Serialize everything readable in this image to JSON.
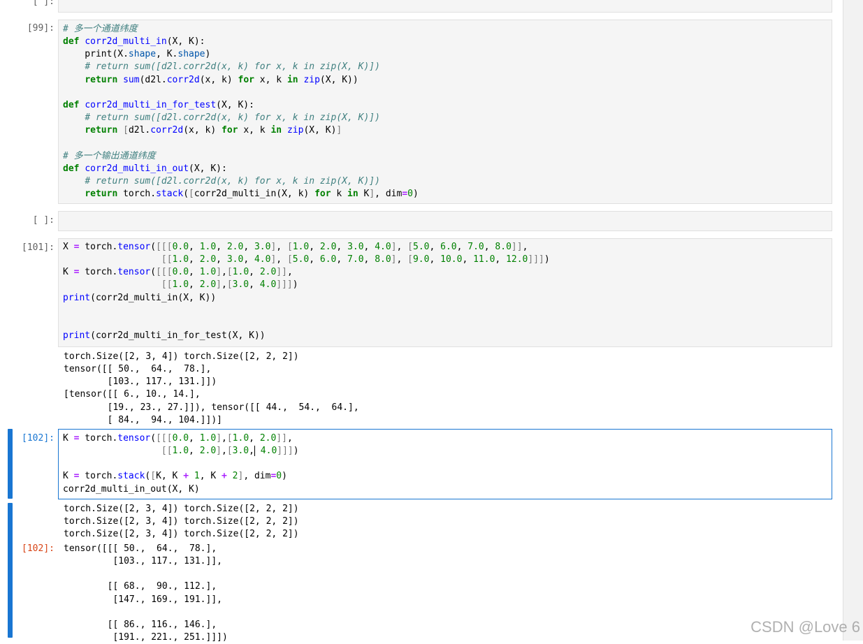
{
  "prompts": {
    "empty": "[ ]:",
    "in99": "[99]:",
    "in101": "[101]:",
    "in102": "[102]:",
    "out102": "[102]:"
  },
  "cell99": {
    "code": [
      "# 多一个通道纬度",
      "def corr2d_multi_in(X, K):",
      "    print(X.shape, K.shape)",
      "    # return sum([d2l.corr2d(x, k) for x, k in zip(X, K)])",
      "    return sum(d2l.corr2d(x, k) for x, k in zip(X, K))",
      "",
      "def corr2d_multi_in_for_test(X, K):",
      "    # return sum([d2l.corr2d(x, k) for x, k in zip(X, K)])",
      "    return [d2l.corr2d(x, k) for x, k in zip(X, K)]",
      "",
      "# 多一个输出通道纬度",
      "def corr2d_multi_in_out(X, K):",
      "    # return sum([d2l.corr2d(x, k) for x, k in zip(X, K)])",
      "    return torch.stack([corr2d_multi_in(X, k) for k in K], dim=0)"
    ]
  },
  "cell101": {
    "code": [
      "X = torch.tensor([[[0.0, 1.0, 2.0, 3.0], [1.0, 2.0, 3.0, 4.0], [5.0, 6.0, 7.0, 8.0]],",
      "                  [[1.0, 2.0, 3.0, 4.0], [5.0, 6.0, 7.0, 8.0], [9.0, 10.0, 11.0, 12.0]]])",
      "K = torch.tensor([[[0.0, 1.0],[1.0, 2.0]],",
      "                  [[1.0, 2.0],[3.0, 4.0]]])",
      "print(corr2d_multi_in(X, K))",
      "",
      "",
      "print(corr2d_multi_in_for_test(X, K))"
    ],
    "output": [
      "torch.Size([2, 3, 4]) torch.Size([2, 2, 2])",
      "tensor([[ 50.,  64.,  78.],",
      "        [103., 117., 131.]])",
      "[tensor([[ 6., 10., 14.],",
      "        [19., 23., 27.]]), tensor([[ 44.,  54.,  64.],",
      "        [ 84.,  94., 104.]])]"
    ]
  },
  "cell102": {
    "code": [
      "K = torch.tensor([[[0.0, 1.0],[1.0, 2.0]],",
      "                  [[1.0, 2.0],[3.0, 4.0]]])",
      "",
      "K = torch.stack([K, K + 1, K + 2], dim=0)",
      "corr2d_multi_in_out(X, K)"
    ],
    "stdout": [
      "torch.Size([2, 3, 4]) torch.Size([2, 2, 2])",
      "torch.Size([2, 3, 4]) torch.Size([2, 2, 2])",
      "torch.Size([2, 3, 4]) torch.Size([2, 2, 2])"
    ],
    "result": [
      "tensor([[[ 50.,  64.,  78.],",
      "         [103., 117., 131.]],",
      "",
      "        [[ 68.,  90., 112.],",
      "         [147., 169., 191.]],",
      "",
      "        [[ 86., 116., 146.],",
      "         [191., 221., 251.]]])"
    ]
  },
  "watermark": "CSDN @Love 6",
  "colors": {
    "accent": "#1976d2",
    "keyword": "#008000",
    "output_prompt": "#d84315"
  }
}
